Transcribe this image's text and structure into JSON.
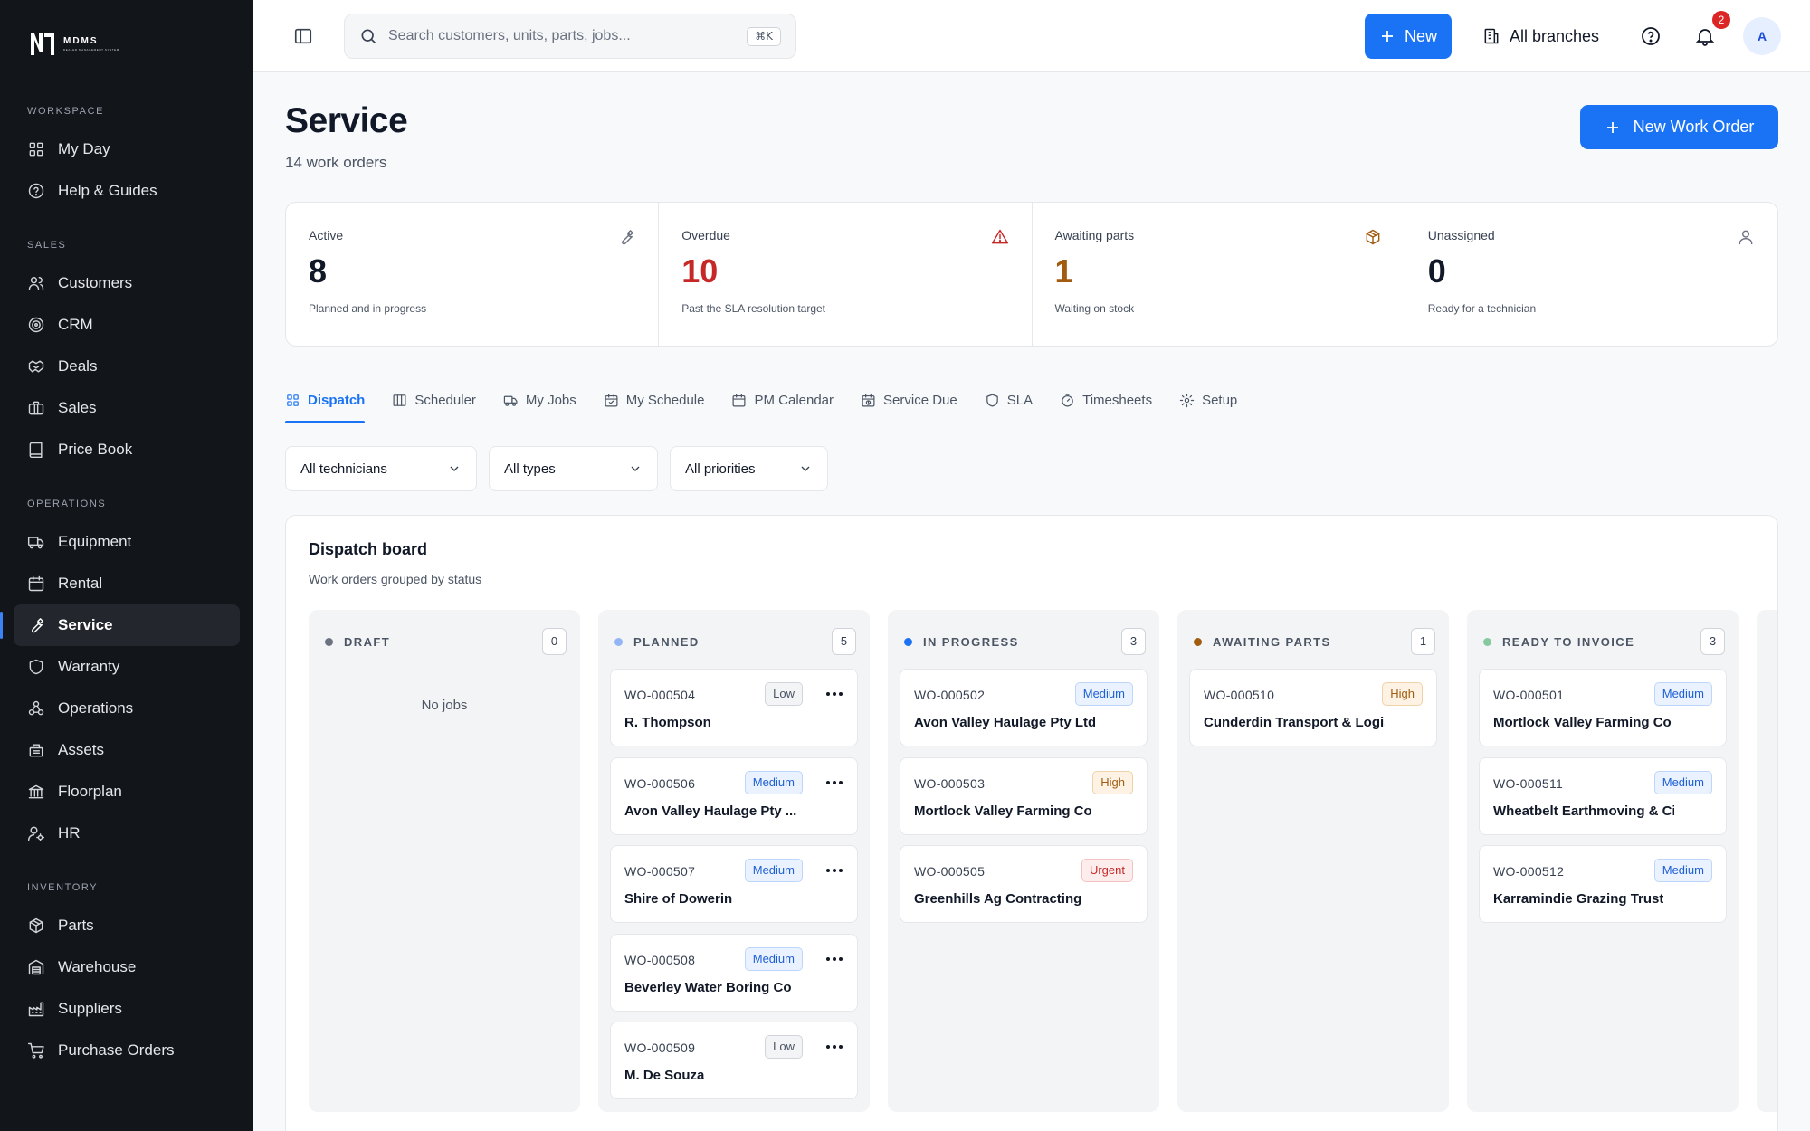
{
  "app": {
    "logo_text": "MDMS",
    "logo_subtext": "DEALER MANAGEMENT SYSTEM"
  },
  "sidebar": {
    "sections": [
      {
        "label": "WORKSPACE",
        "items": [
          {
            "label": "My Day",
            "icon": "grid-icon"
          },
          {
            "label": "Help & Guides",
            "icon": "help-icon"
          }
        ]
      },
      {
        "label": "SALES",
        "items": [
          {
            "label": "Customers",
            "icon": "users-icon"
          },
          {
            "label": "CRM",
            "icon": "target-icon"
          },
          {
            "label": "Deals",
            "icon": "handshake-icon"
          },
          {
            "label": "Sales",
            "icon": "briefcase-icon"
          },
          {
            "label": "Price Book",
            "icon": "book-icon"
          }
        ]
      },
      {
        "label": "OPERATIONS",
        "items": [
          {
            "label": "Equipment",
            "icon": "truck-icon"
          },
          {
            "label": "Rental",
            "icon": "calendar-icon"
          },
          {
            "label": "Service",
            "icon": "wrench-icon"
          },
          {
            "label": "Warranty",
            "icon": "shield-icon"
          },
          {
            "label": "Operations",
            "icon": "hub-icon"
          },
          {
            "label": "Assets",
            "icon": "assets-icon"
          },
          {
            "label": "Floorplan",
            "icon": "bank-icon"
          },
          {
            "label": "HR",
            "icon": "user-cog-icon"
          }
        ]
      },
      {
        "label": "INVENTORY",
        "items": [
          {
            "label": "Parts",
            "icon": "package-icon"
          },
          {
            "label": "Warehouse",
            "icon": "warehouse-icon"
          },
          {
            "label": "Suppliers",
            "icon": "factory-icon"
          },
          {
            "label": "Purchase Orders",
            "icon": "cart-icon"
          }
        ]
      }
    ],
    "active": "Service"
  },
  "topbar": {
    "search_placeholder": "Search customers, units, parts, jobs...",
    "search_shortcut": "⌘K",
    "new_label": "New",
    "branches_label": "All branches",
    "notification_count": "2",
    "avatar_initial": "A"
  },
  "page": {
    "title": "Service",
    "subtitle": "14 work orders",
    "new_work_order_label": "New Work Order"
  },
  "stats": [
    {
      "label": "Active",
      "value": "8",
      "note": "Planned and in progress",
      "icon": "wrench-icon",
      "color": "#111827"
    },
    {
      "label": "Overdue",
      "value": "10",
      "note": "Past the SLA resolution target",
      "icon": "alert-triangle-icon",
      "color": "#c62828"
    },
    {
      "label": "Awaiting parts",
      "value": "1",
      "note": "Waiting on stock",
      "icon": "package-icon",
      "color": "#a15c0f"
    },
    {
      "label": "Unassigned",
      "value": "0",
      "note": "Ready for a technician",
      "icon": "user-icon",
      "color": "#111827"
    }
  ],
  "tabs": [
    {
      "label": "Dispatch",
      "icon": "grid-icon",
      "active": true
    },
    {
      "label": "Scheduler",
      "icon": "columns-icon",
      "active": false
    },
    {
      "label": "My Jobs",
      "icon": "truck-icon",
      "active": false
    },
    {
      "label": "My Schedule",
      "icon": "calendar-check-icon",
      "active": false
    },
    {
      "label": "PM Calendar",
      "icon": "calendar-icon",
      "active": false
    },
    {
      "label": "Service Due",
      "icon": "calendar-clock-icon",
      "active": false
    },
    {
      "label": "SLA",
      "icon": "shield-icon",
      "active": false
    },
    {
      "label": "Timesheets",
      "icon": "timer-icon",
      "active": false
    },
    {
      "label": "Setup",
      "icon": "gear-icon",
      "active": false
    }
  ],
  "filters": [
    {
      "value": "All technicians"
    },
    {
      "value": "All types"
    },
    {
      "value": "All priorities"
    }
  ],
  "board": {
    "title": "Dispatch board",
    "subtitle": "Work orders grouped by status",
    "columns": [
      {
        "title": "DRAFT",
        "count": "0",
        "dot_color": "#6b7280",
        "empty_text": "No jobs",
        "cards": []
      },
      {
        "title": "PLANNED",
        "count": "5",
        "dot_color": "#93b4f5",
        "cards": [
          {
            "id": "WO-000504",
            "name": "R. Thompson",
            "priority": "Low"
          },
          {
            "id": "WO-000506",
            "name": "Avon Valley Haulage Pty ...",
            "priority": "Medium"
          },
          {
            "id": "WO-000507",
            "name": "Shire of Dowerin",
            "priority": "Medium"
          },
          {
            "id": "WO-000508",
            "name": "Beverley Water Boring Co",
            "priority": "Medium"
          },
          {
            "id": "WO-000509",
            "name": "M. De Souza",
            "priority": "Low"
          }
        ]
      },
      {
        "title": "IN PROGRESS",
        "count": "3",
        "dot_color": "#1a73f5",
        "cards": [
          {
            "id": "WO-000502",
            "name": "Avon Valley Haulage Pty Ltd",
            "priority": "Medium"
          },
          {
            "id": "WO-000503",
            "name": "Mortlock Valley Farming Co",
            "priority": "High"
          },
          {
            "id": "WO-000505",
            "name": "Greenhills Ag Contracting",
            "priority": "Urgent"
          }
        ]
      },
      {
        "title": "AWAITING PARTS",
        "count": "1",
        "dot_color": "#a15c0f",
        "cards": [
          {
            "id": "WO-000510",
            "name": "Cunderdin Transport & Logistics",
            "priority": "High"
          }
        ]
      },
      {
        "title": "READY TO INVOICE",
        "count": "3",
        "dot_color": "#86c9a0",
        "cards": [
          {
            "id": "WO-000501",
            "name": "Mortlock Valley Farming Co",
            "priority": "Medium"
          },
          {
            "id": "WO-000511",
            "name": "Wheatbelt Earthmoving & Civil",
            "priority": "Medium"
          },
          {
            "id": "WO-000512",
            "name": "Karramindie Grazing Trust",
            "priority": "Medium"
          }
        ]
      }
    ]
  }
}
